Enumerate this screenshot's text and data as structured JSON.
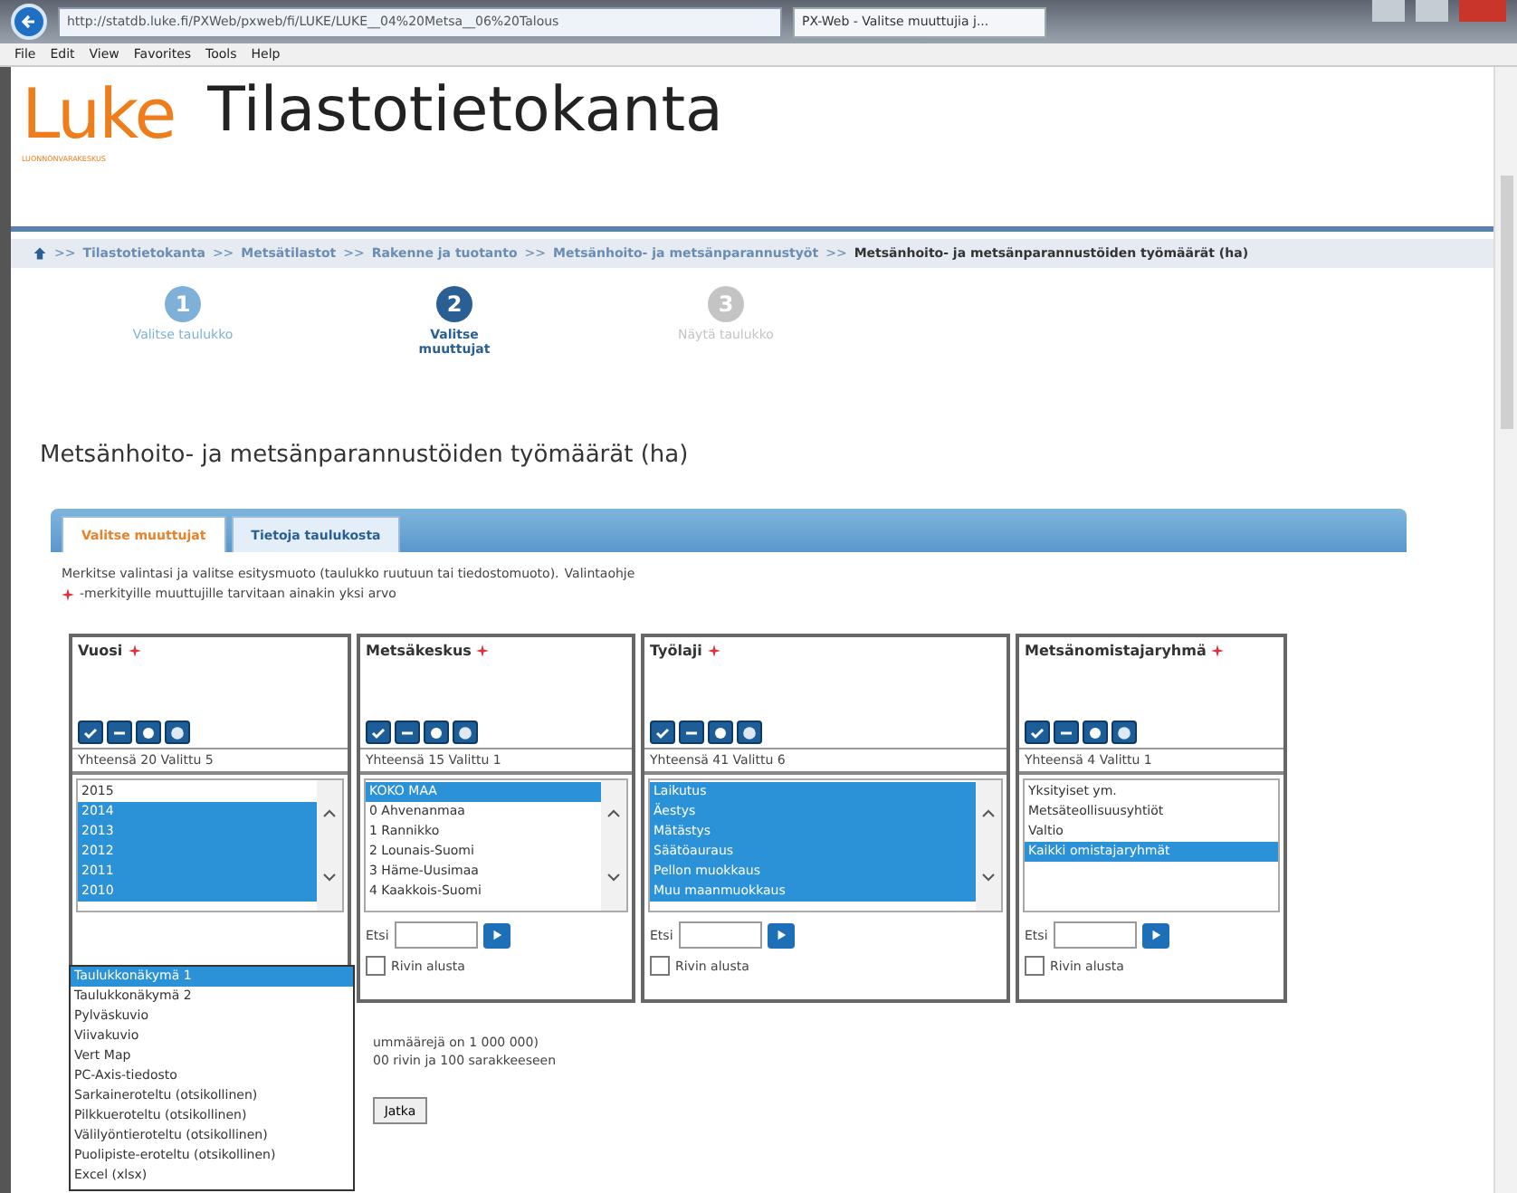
{
  "browser": {
    "address": "http://statdb.luke.fi/PXWeb/pxweb/fi/LUKE/LUKE__04%20Metsa__06%20Talous",
    "tab_title": "PX-Web - Valitse muuttujia j...",
    "menu": [
      "File",
      "Edit",
      "View",
      "Favorites",
      "Tools",
      "Help"
    ]
  },
  "header": {
    "logo": "Luke",
    "logo_subtitle": "LUONNONVARAKESKUS",
    "title": "Tilastotietokanta"
  },
  "breadcrumb_separator": ">>",
  "breadcrumb": [
    {
      "label": "Tilastotietokanta"
    },
    {
      "label": "Metsätilastot"
    },
    {
      "label": "Rakenne ja tuotanto"
    },
    {
      "label": "Metsänhoito- ja metsänparannustyöt"
    },
    {
      "label": "Metsänhoito- ja metsänparannustöiden työmäärät (ha)"
    }
  ],
  "steps": [
    {
      "number": "1",
      "label": "Valitse taulukko",
      "kind": "done"
    },
    {
      "number": "2",
      "label": "Valitse muuttujat",
      "kind": "current"
    },
    {
      "number": "3",
      "label": "Näytä taulukko",
      "kind": "pending"
    }
  ],
  "page_title": "Metsänhoito- ja metsänparannustöiden työmäärät (ha)",
  "tabs": [
    {
      "label": "Valitse muuttujat",
      "selected": true
    },
    {
      "label": "Tietoja taulukosta",
      "selected": false
    }
  ],
  "instructions": {
    "text": "Merkitse valintasi ja valitse esitysmuoto (taulukko ruutuun tai tiedostomuoto).",
    "link": "Valintaohje",
    "required_note": "-merkityille muuttujille tarvitaan ainakin yksi arvo"
  },
  "variables": [
    {
      "name": "Vuosi",
      "required": true,
      "count": "Yhteensä 20 Valittu 5",
      "items": [
        {
          "label": "2015",
          "selected": false
        },
        {
          "label": "2014",
          "selected": true
        },
        {
          "label": "2013",
          "selected": true
        },
        {
          "label": "2012",
          "selected": true
        },
        {
          "label": "2011",
          "selected": true
        },
        {
          "label": "2010",
          "selected": true
        }
      ]
    },
    {
      "name": "Metsäkeskus",
      "required": true,
      "count": "Yhteensä 15 Valittu 1",
      "items": [
        {
          "label": "KOKO MAA",
          "selected": true
        },
        {
          "label": "0 Ahvenanmaa",
          "selected": false
        },
        {
          "label": "1 Rannikko",
          "selected": false
        },
        {
          "label": "2 Lounais-Suomi",
          "selected": false
        },
        {
          "label": "3 Häme-Uusimaa",
          "selected": false
        },
        {
          "label": "4 Kaakkois-Suomi",
          "selected": false
        }
      ],
      "search_label": "Etsi",
      "option_label": "Rivin alusta",
      "option_checked": false
    },
    {
      "name": "Työlaji",
      "required": true,
      "count": "Yhteensä 41 Valittu 6",
      "items": [
        {
          "label": "Laikutus",
          "selected": true
        },
        {
          "label": "Äestys",
          "selected": true
        },
        {
          "label": "Mätästys",
          "selected": true
        },
        {
          "label": "Säätöauraus",
          "selected": true
        },
        {
          "label": "Pellon muokkaus",
          "selected": true
        },
        {
          "label": "Muu maanmuokkaus",
          "selected": true
        }
      ],
      "search_label": "Etsi",
      "option_label": "Rivin alusta",
      "option_checked": false
    },
    {
      "name": "Metsänomistajaryhmä",
      "required": true,
      "count": "Yhteensä 4 Valittu 1",
      "items": [
        {
          "label": "Yksityiset ym.",
          "selected": false
        },
        {
          "label": "Metsäteollisuusyhtiöt",
          "selected": false
        },
        {
          "label": "Valtio",
          "selected": false
        },
        {
          "label": "Kaikki omistajaryhmät",
          "selected": true
        }
      ],
      "search_label": "Etsi",
      "option_label": "Rivin alusta",
      "option_checked": false
    }
  ],
  "format_dropdown": [
    {
      "label": "Taulukkonäkymä 1",
      "selected": true
    },
    {
      "label": "Taulukkonäkymä 2",
      "selected": false
    },
    {
      "label": "Pylväskuvio",
      "selected": false
    },
    {
      "label": "Viivakuvio",
      "selected": false
    },
    {
      "label": "Vert Map",
      "selected": false
    },
    {
      "label": "PC-Axis-tiedosto",
      "selected": false
    },
    {
      "label": "Sarkaineroteltu (otsikollinen)",
      "selected": false
    },
    {
      "label": "Pilkkueroteltu (otsikollinen)",
      "selected": false
    },
    {
      "label": "Välilyöntieroteltu (otsikollinen)",
      "selected": false
    },
    {
      "label": "Puolipiste-eroteltu (otsikollinen)",
      "selected": false
    },
    {
      "label": "Excel (xlsx)",
      "selected": false
    }
  ],
  "notes": [
    "ummäärejä on 1 000 000)",
    "00 rivin ja 100 sarakkeeseen"
  ],
  "continue_button": "Jatka"
}
